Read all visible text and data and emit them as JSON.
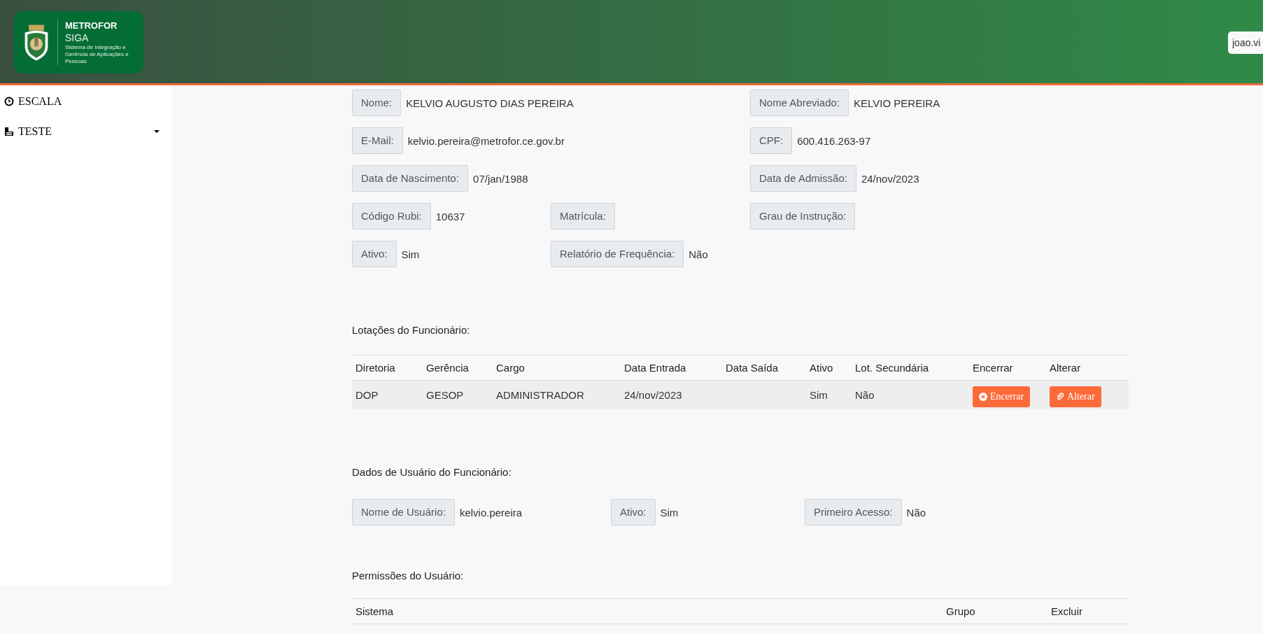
{
  "header": {
    "logo": {
      "title": "METROFOR",
      "subtitle": "SIGA",
      "tagline": "Sistema de Integração e Gerência de Aplicações e Pessoas"
    },
    "user_field": {
      "value": "joao.vi"
    }
  },
  "sidebar": {
    "items": [
      {
        "label": "ESCALA",
        "kind": "clock",
        "has_caret": false
      },
      {
        "label": "TESTE",
        "kind": "document",
        "has_caret": true
      }
    ]
  },
  "employee": {
    "rows": [
      {
        "left": {
          "label": "Nome:",
          "value": "KELVIO AUGUSTO DIAS PEREIRA"
        },
        "right": {
          "label": "Nome Abreviado:",
          "value": "KELVIO PEREIRA"
        }
      },
      {
        "left": {
          "label": "E-Mail:",
          "value": "kelvio.pereira@metrofor.ce.gov.br"
        },
        "right": {
          "label": "CPF:",
          "value": "600.416.263-97"
        }
      },
      {
        "left": {
          "label": "Data de Nascimento:",
          "value": "07/jan/1988"
        },
        "right": {
          "label": "Data de Admissão:",
          "value": "24/nov/2023"
        }
      },
      {
        "left": {
          "label": "Código Rubi:",
          "value": "10637"
        },
        "middle": {
          "label": "Matrícula:"
        },
        "right": {
          "label": "Grau de Instrução:"
        }
      },
      {
        "left": {
          "label": "Ativo:",
          "value": "Sim"
        },
        "middle": {
          "label": "Relatório de Frequência:",
          "value": "Não"
        }
      }
    ]
  },
  "assignments": {
    "title": "Lotações do Funcionário:",
    "columns": [
      "Diretoria",
      "Gerência",
      "Cargo",
      "Data Entrada",
      "Data Saída",
      "Ativo",
      "Lot. Secundária",
      "Encerrar",
      "Alterar"
    ],
    "rows": [
      {
        "cells": [
          "DOP",
          "GESOP",
          "ADMINISTRADOR",
          "24/nov/2023",
          "",
          "Sim",
          "Não"
        ],
        "end_button": "Encerrar",
        "edit_button": "Alterar"
      }
    ]
  },
  "user_data": {
    "title": "Dados de Usuário do Funcionário:",
    "fields": [
      {
        "label": "Nome de Usuário:",
        "value": "kelvio.pereira"
      },
      {
        "label": "Ativo:",
        "value": "Sim"
      },
      {
        "label": "Primeiro Acesso:",
        "value": "Não"
      }
    ]
  },
  "permissions": {
    "title": "Permissões do Usuário:",
    "columns": [
      "Sistema",
      "Grupo",
      "Excluir"
    ]
  }
}
